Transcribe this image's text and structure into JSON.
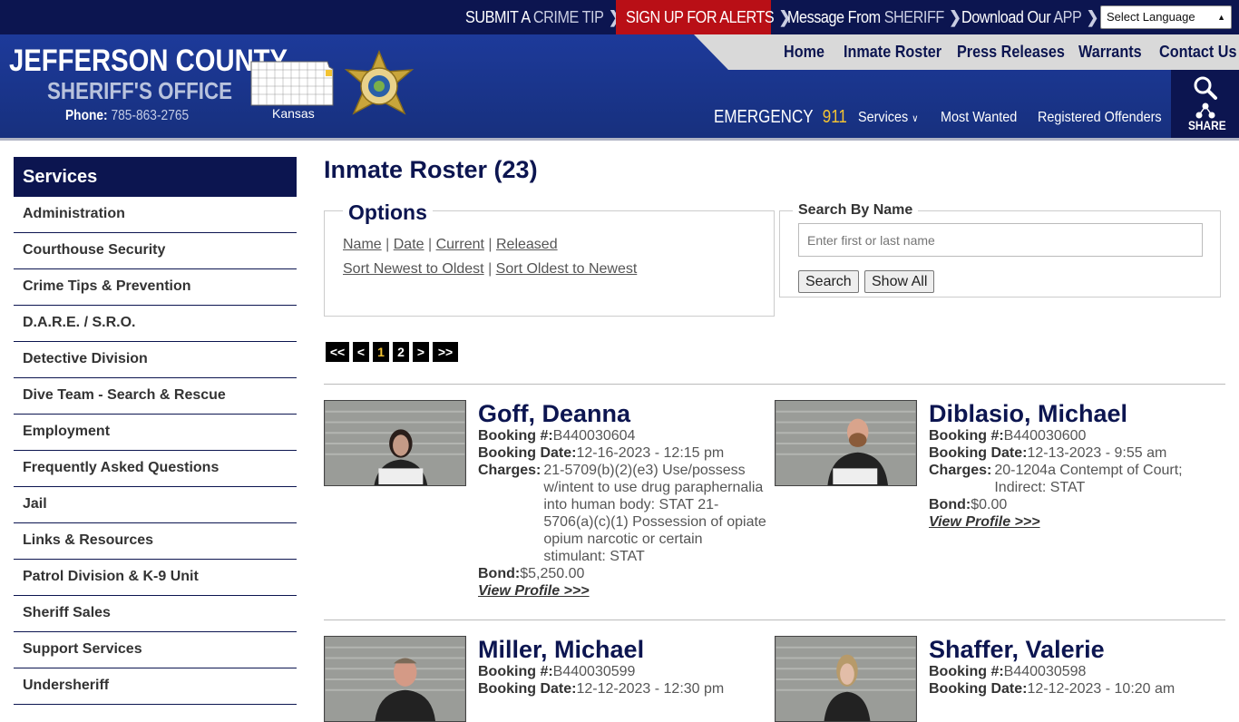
{
  "topbar": {
    "crime_tip": {
      "a": "SUBMIT A",
      "b": "CRIME TIP"
    },
    "alerts": {
      "a": "SIGN UP FOR ALERTS"
    },
    "sheriff_msg": {
      "a": "Message From",
      "b": "SHERIFF"
    },
    "app": {
      "a": "Download Our",
      "b": "APP"
    },
    "language": "Select Language"
  },
  "brand": {
    "line1": "JEFFERSON COUNTY",
    "line2": "SHERIFF'S OFFICE",
    "phone_label": "Phone:",
    "phone": "785-863-2765",
    "state": "Kansas"
  },
  "nav_main": [
    "Home",
    "Inmate Roster",
    "Press Releases",
    "Warrants",
    "Contact Us"
  ],
  "nav_sub": {
    "emergency_label": "EMERGENCY",
    "emergency_num": "911",
    "services": "Services",
    "most_wanted": "Most Wanted",
    "registered": "Registered Offenders",
    "share": "SHARE"
  },
  "sidebar": {
    "title": "Services",
    "items": [
      "Administration",
      "Courthouse Security",
      "Crime Tips & Prevention",
      "D.A.R.E. / S.R.O.",
      "Detective Division",
      "Dive Team - Search & Rescue",
      "Employment",
      "Frequently Asked Questions",
      "Jail",
      "Links & Resources",
      "Patrol Division & K-9 Unit",
      "Sheriff Sales",
      "Support Services",
      "Undersheriff"
    ]
  },
  "main": {
    "title": "Inmate Roster (23)",
    "options": {
      "legend": "Options",
      "sort1": [
        "Name",
        "Date",
        "Current",
        "Released"
      ],
      "sort2": [
        "Sort Newest to Oldest",
        "Sort Oldest to Newest"
      ]
    },
    "search": {
      "legend": "Search By Name",
      "placeholder": "Enter first or last name",
      "search_btn": "Search",
      "show_all_btn": "Show All"
    },
    "pager": [
      "<<",
      "<",
      "1",
      "2",
      ">",
      ">>"
    ],
    "labels": {
      "booking_no": "Booking #:",
      "booking_date": "Booking Date:",
      "charges": "Charges:",
      "bond": "Bond:",
      "view_profile": "View Profile >>>"
    },
    "inmates": [
      {
        "name": "Goff, Deanna",
        "booking_no": "B440030604",
        "booking_date": "12-16-2023 - 12:15 pm",
        "charges": "21-5709(b)(2)(e3) Use/possess w/intent to use drug paraphernalia into human body: STAT 21-5706(a)(c)(1) Possession of opiate opium narcotic or certain stimulant: STAT",
        "bond": "$5,250.00"
      },
      {
        "name": "Diblasio, Michael",
        "booking_no": "B440030600",
        "booking_date": "12-13-2023 - 9:55 am",
        "charges": "20-1204a Contempt of Court; Indirect: STAT",
        "bond": "$0.00"
      },
      {
        "name": "Miller, Michael",
        "booking_no": "B440030599",
        "booking_date": "12-12-2023 - 12:30 pm",
        "charges": "",
        "bond": ""
      },
      {
        "name": "Shaffer, Valerie",
        "booking_no": "B440030598",
        "booking_date": "12-12-2023 - 10:20 am",
        "charges": "",
        "bond": ""
      }
    ]
  },
  "colors": {
    "navy": "#0c1550",
    "header_blue": "#1d3a9a",
    "alert_red": "#b90f16",
    "gold": "#f3c333"
  }
}
